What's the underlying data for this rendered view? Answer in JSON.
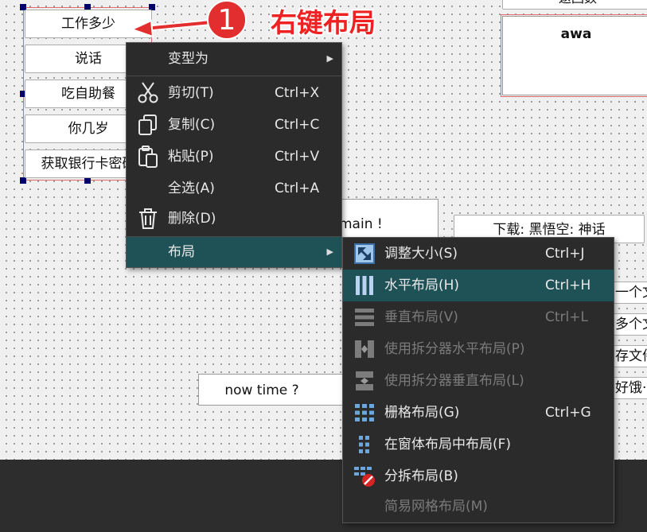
{
  "canvas": {
    "selected_buttons": [
      "工作多少",
      "说话",
      "吃自助餐",
      "你几岁",
      "获取银行卡密码"
    ],
    "main_label": "main !",
    "now_time_label": "now time ?",
    "download_button": "下载: 黑悟空: 神话",
    "top_right_button": "返回数",
    "text_box_value": "awa",
    "right_side_buttons": [
      "一个文",
      "多个文",
      "存文件",
      "好饿·"
    ]
  },
  "annotation": {
    "number": "1",
    "caption": "右键布局",
    "color": "#ee2222"
  },
  "context_menu": {
    "items": [
      {
        "label": "变型为",
        "shortcut": "",
        "has_submenu": true,
        "icon": ""
      },
      {
        "label": "剪切(T)",
        "shortcut": "Ctrl+X",
        "icon": "scissors-icon"
      },
      {
        "label": "复制(C)",
        "shortcut": "Ctrl+C",
        "icon": "copy-icon"
      },
      {
        "label": "粘贴(P)",
        "shortcut": "Ctrl+V",
        "icon": "paste-icon"
      },
      {
        "label": "全选(A)",
        "shortcut": "Ctrl+A",
        "icon": ""
      },
      {
        "label": "删除(D)",
        "shortcut": "",
        "icon": "trash-icon"
      },
      {
        "label": "布局",
        "shortcut": "",
        "has_submenu": true,
        "highlighted": true,
        "icon": ""
      }
    ]
  },
  "layout_submenu": {
    "items": [
      {
        "label": "调整大小(S)",
        "shortcut": "Ctrl+J",
        "enabled": true,
        "icon": "adjust-size-icon"
      },
      {
        "label": "水平布局(H)",
        "shortcut": "Ctrl+H",
        "enabled": true,
        "highlighted": true,
        "icon": "horizontal-layout-icon"
      },
      {
        "label": "垂直布局(V)",
        "shortcut": "Ctrl+L",
        "enabled": false,
        "icon": "vertical-layout-icon"
      },
      {
        "label": "使用拆分器水平布局(P)",
        "shortcut": "",
        "enabled": false,
        "icon": "splitter-horizontal-icon"
      },
      {
        "label": "使用拆分器垂直布局(L)",
        "shortcut": "",
        "enabled": false,
        "icon": "splitter-vertical-icon"
      },
      {
        "label": "栅格布局(G)",
        "shortcut": "Ctrl+G",
        "enabled": true,
        "icon": "grid-layout-icon"
      },
      {
        "label": "在窗体布局中布局(F)",
        "shortcut": "",
        "enabled": true,
        "icon": "form-layout-icon"
      },
      {
        "label": "分拆布局(B)",
        "shortcut": "",
        "enabled": true,
        "icon": "break-layout-icon"
      },
      {
        "label": "简易网格布局(M)",
        "shortcut": "",
        "enabled": false,
        "icon": ""
      }
    ]
  }
}
